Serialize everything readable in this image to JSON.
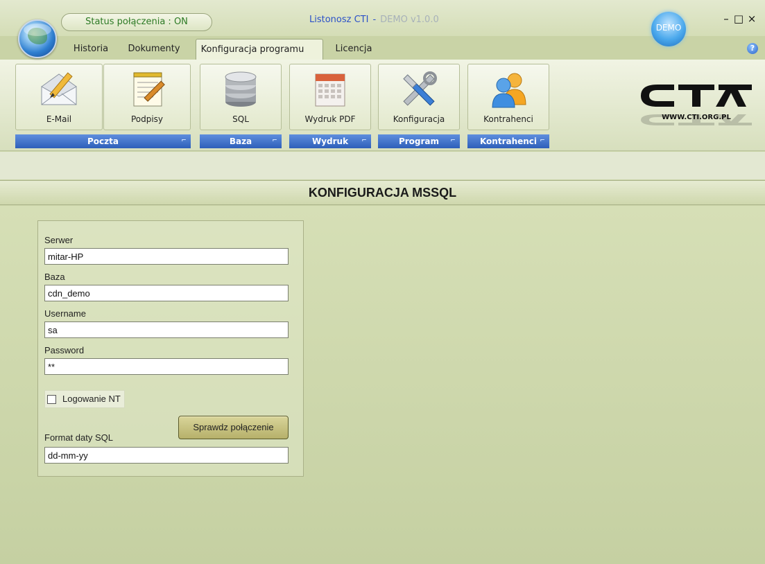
{
  "titlebar": {
    "connection_status": "Status połączenia : ON",
    "app_name": "Listonosz CTI",
    "separator": "-",
    "version": "DEMO v1.0.0",
    "demo_badge": "DEMO",
    "minimize": "–",
    "maximize": "□",
    "close": "×"
  },
  "tabs": [
    {
      "label": "Historia"
    },
    {
      "label": "Dokumenty"
    },
    {
      "label": "Konfiguracja programu",
      "active": true
    },
    {
      "label": "Licencja"
    }
  ],
  "help_icon": "?",
  "ribbon": {
    "buttons": [
      {
        "label": "E-Mail",
        "icon": "email-icon"
      },
      {
        "label": "Podpisy",
        "icon": "signature-notepad-icon"
      },
      {
        "label": "SQL",
        "icon": "database-icon"
      },
      {
        "label": "Wydruk PDF",
        "icon": "calendar-pdf-icon"
      },
      {
        "label": "Konfiguracja",
        "icon": "tools-icon"
      },
      {
        "label": "Kontrahenci",
        "icon": "contacts-icon"
      }
    ],
    "groups": [
      {
        "label": "Poczta"
      },
      {
        "label": "Baza"
      },
      {
        "label": "Wydruk"
      },
      {
        "label": "Program"
      },
      {
        "label": "Kontrahenci"
      }
    ],
    "logo_url": "WWW.CTI.ORG.PL"
  },
  "section": {
    "title": "KONFIGURACJA MSSQL"
  },
  "form": {
    "server_label": "Serwer",
    "server_value": "mitar-HP",
    "database_label": "Baza",
    "database_value": "cdn_demo",
    "username_label": "Username",
    "username_value": "sa",
    "password_label": "Password",
    "password_value": "**",
    "nt_login_label": "Logowanie NT",
    "nt_login_checked": false,
    "test_button": "Sprawdz połączenie",
    "date_format_label": "Format daty SQL",
    "date_format_value": "dd-mm-yy"
  },
  "colors": {
    "accent_blue": "#2e5fb9",
    "status_green": "#2d7a24",
    "background": "#c9d3a6"
  }
}
